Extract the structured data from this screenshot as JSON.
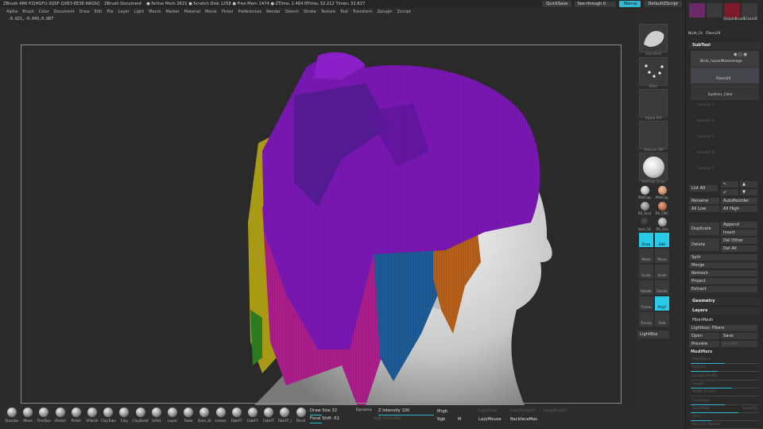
{
  "titlebar": {
    "items": [
      "ZBrush 4R6 P2[HGFU-3QSF-QXE3-EE3E-NKGN]",
      "ZBrush Document",
      "● Active Mem 2621 ● Scratch Disk 1258 ● Free Mem 1474 ● ZTime₁ 1.484 RTime₂ 32.212 Timer₃ 32.827"
    ],
    "quicksave": "QuickSave",
    "seethrough_label": "See-through",
    "seethrough_value": "0",
    "seethrough_level": 0.0,
    "menus": "Menus",
    "default_script": "DefaultZScript"
  },
  "menubar": [
    "Alpha",
    "Brush",
    "Color",
    "Document",
    "Draw",
    "Edit",
    "File",
    "Layer",
    "Light",
    "Macro",
    "Marker",
    "Material",
    "Movie",
    "Picker",
    "Preferences",
    "Render",
    "Stencil",
    "Stroke",
    "Texture",
    "Tool",
    "Transform",
    "Zplugin",
    "Zscript"
  ],
  "coord": "-0.021,-0.043,0.087",
  "shelf": {
    "alpha_label": "Alpha Off",
    "texture_label": "Texture Off",
    "material_label": "MatCap Gray",
    "stroke_label": "Dots",
    "brush_label": "Standard",
    "materials": [
      "MatCap",
      "MatCap",
      "RS_Scul",
      "RS_ORC",
      "zbro_Sil",
      "RS_Gre"
    ],
    "draw": "Draw",
    "edit": "Edit",
    "move": "Move",
    "scale": "Scale",
    "rotate": "Rotate",
    "move2": "Move",
    "scale2": "Scale",
    "rotate2": "Rotate",
    "frame": "Frame",
    "polyf": "PolyF",
    "transp": "Transp",
    "solo": "Solo",
    "lightbox": "LightBox"
  },
  "rpanel": {
    "top_tools": [
      "Nickt_Fe",
      "Fibers29",
      "SimpleBrush",
      "EraserB"
    ],
    "subtool_header": "SubTool",
    "subtools": [
      "Nickt_hasselMaskverage",
      "Fibers29",
      "Eyeliner_Color"
    ],
    "subtool_empty": [
      "Subtool 3",
      "Subtool 4",
      "Subtool 5",
      "Subtool 6",
      "Subtool 7"
    ],
    "list_all": "List All",
    "rename": "Rename",
    "auto_reorder": "AutoReorder",
    "all_low": "All Low",
    "all_high": "All High",
    "duplicate": "Duplicate",
    "append": "Append",
    "insert": "Insert",
    "delete": "Delete",
    "del_other": "Del Other",
    "del_all": "Del All",
    "split": "Split",
    "merge": "Merge",
    "remesh": "Remesh",
    "project": "Project",
    "extract": "Extract",
    "geometry": "Geometry",
    "layers": "Layers",
    "fibermesh": "FiberMesh",
    "lightbox_fibers": "Lightbox› Fibers",
    "open": "Open",
    "save": "Save",
    "preview": "Preview",
    "accept": "Accept",
    "modifiers": "Modifiers",
    "mod_rows": [
      {
        "l": "MaxFibers",
        "r": "",
        "fill": 0.5
      },
      {
        "l": "ByArea",
        "r": "",
        "fill": 0.4
      },
      {
        "l": "Length Profile",
        "r": "",
        "fill": 0.0
      },
      {
        "l": "Length",
        "r": "",
        "fill": 0.6
      },
      {
        "l": "Width Profile",
        "r": "",
        "fill": 0.0
      },
      {
        "l": "Coverage",
        "r": "",
        "fill": 0.5
      },
      {
        "l": "ScaleRoot",
        "r": "ScaleTip",
        "fill": 0.7
      },
      {
        "l": "Slim",
        "r": "",
        "fill": 0.3
      },
      {
        "l": "Revolve Radius",
        "r": "",
        "fill": 0.0
      }
    ]
  },
  "brushes": [
    "Standar",
    "Move",
    "TrimDyn",
    "sPolish",
    "Polish",
    "hPolish",
    "ClayTubs",
    "Clay",
    "ClayBuild",
    "Inflat",
    "Layer",
    "Rake",
    "Dam_St",
    "crease",
    "FabrFF",
    "FabrFF",
    "FabrFF",
    "FabrFF_I",
    "Pinch"
  ],
  "draw": {
    "draw_size_label": "Draw Size",
    "draw_size": "32",
    "dynamic": "Dynamic",
    "z_intensity_label": "Z Intensity",
    "z_intensity": "100",
    "focal_shift_label": "Focal Shift",
    "focal_shift": "-51",
    "rgb_intensity": "Rgb Intensity",
    "mrgb": "Mrgb",
    "rgb": "Rgb",
    "m": "M",
    "lazystep": "LazyStep",
    "lazysmooth": "LazySmooth",
    "lazyradius": "LazyRadius",
    "lazymouse": "LazyMouse",
    "backfacemask": "BackfaceMas",
    "draw_size_level": 0.3,
    "z_intensity_level": 1.0,
    "focal_shift_level": 0.25
  },
  "colors": {
    "accent": "#2fb8d8",
    "hair_purple": "#7d18b8",
    "hair_magenta": "#b01e8e",
    "hair_blue": "#1d5e9a",
    "hair_orange": "#b9621c",
    "hair_yellow": "#a99a16"
  }
}
